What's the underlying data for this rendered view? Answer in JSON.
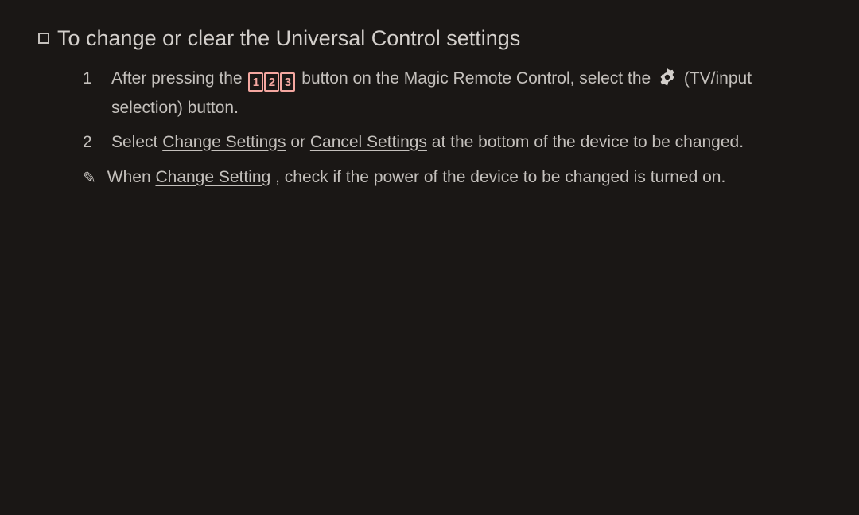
{
  "heading": "To change or clear the Universal Control settings",
  "steps": {
    "s1_num": "1",
    "s1_a": "After pressing the ",
    "s1_b": " button on the Magic Remote Control, select the ",
    "s1_c": " (TV/input selection) button.",
    "s2_num": "2",
    "s2_a": "Select ",
    "s2_change": "Change Settings",
    "s2_or": " or ",
    "s2_cancel": "Cancel Settings",
    "s2_b": " at the bottom of the device to be changed."
  },
  "remote123": {
    "d1": "1",
    "d2": "2",
    "d3": "3"
  },
  "note": {
    "mark": "✎",
    "a": "When ",
    "change": "Change Setting",
    "b": ", check if the power of the device to be changed is turned on."
  }
}
